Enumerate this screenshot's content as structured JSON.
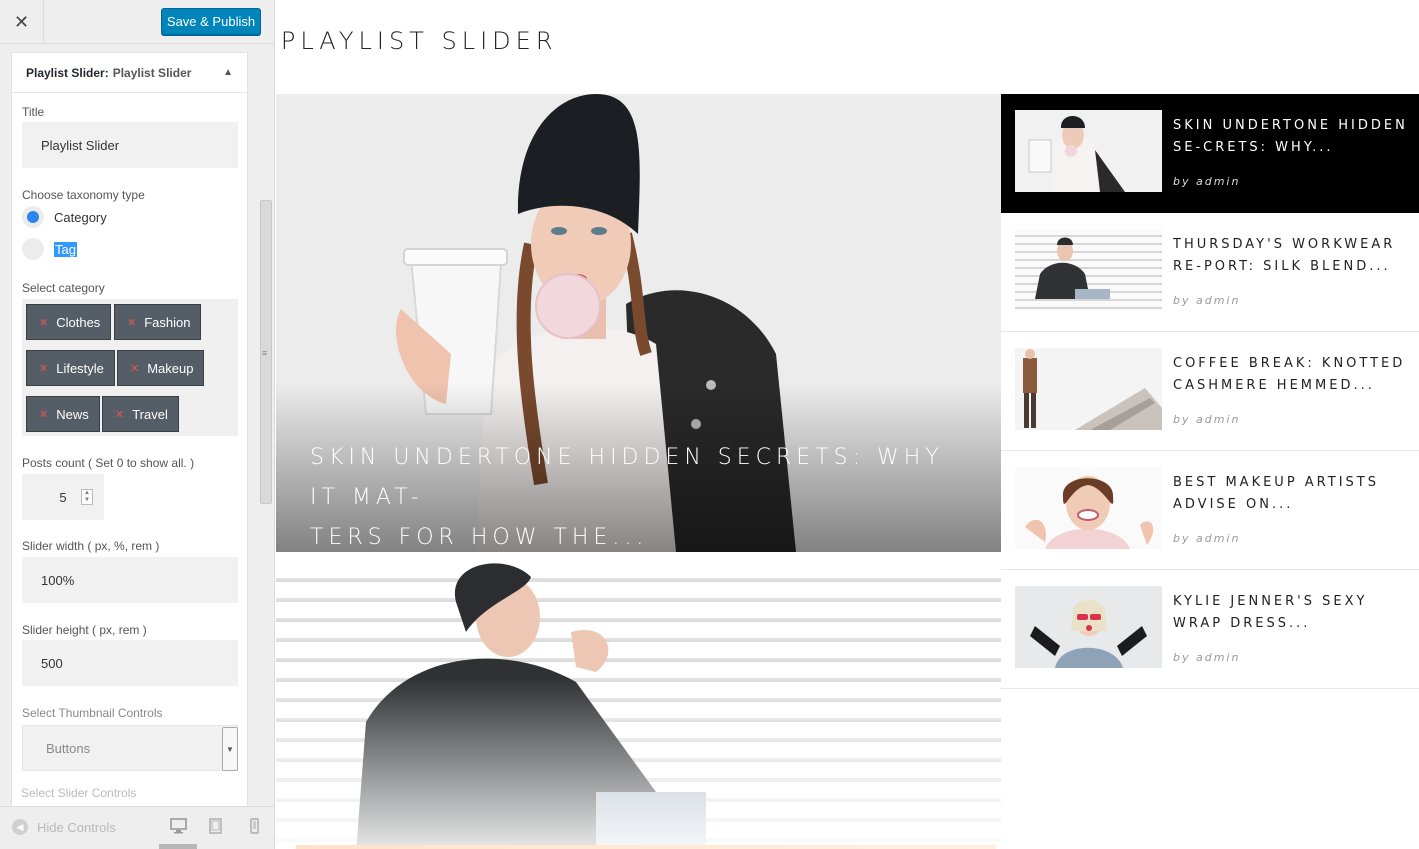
{
  "header": {
    "close_icon": "close-icon",
    "save_label": "Save & Publish"
  },
  "widget": {
    "title_prefix": "Playlist Slider:",
    "title_name": "Playlist Slider",
    "title_label": "Title",
    "title_value": "Playlist Slider",
    "taxonomy_label": "Choose taxonomy type",
    "taxonomy_options": [
      "Category",
      "Tag"
    ],
    "taxonomy_selected": "Category",
    "category_label": "Select category",
    "categories": [
      "Clothes",
      "Fashion",
      "Lifestyle",
      "Makeup",
      "News",
      "Travel"
    ],
    "posts_count_label": "Posts count ( Set 0 to show all. )",
    "posts_count_value": "5",
    "slider_width_label": "Slider width ( px, %, rem )",
    "slider_width_value": "100%",
    "slider_height_label": "Slider height ( px, rem )",
    "slider_height_value": "500",
    "thumb_controls_label": "Select Thumbnail Controls",
    "thumb_controls_value": "Buttons",
    "slider_controls_label": "Select Slider Controls"
  },
  "footer": {
    "hide_controls_label": "Hide Controls",
    "devices": [
      "desktop-icon",
      "tablet-icon",
      "mobile-icon"
    ]
  },
  "preview": {
    "page_title": "PLAYLIST SLIDER",
    "hero_caption_line1": "SKIN UNDERTONE HIDDEN SECRETS: WHY IT MAT-",
    "hero_caption_line2": "TERS FOR HOW THE...",
    "thumbs": [
      {
        "title": "SKIN UNDERTONE HIDDEN SE-CRETS: WHY...",
        "by": "by admin"
      },
      {
        "title": "THURSDAY'S WORKWEAR RE-PORT: SILK BLEND...",
        "by": "by admin"
      },
      {
        "title": "COFFEE BREAK: KNOTTED CASHMERE HEMMED...",
        "by": "by admin"
      },
      {
        "title": "BEST MAKEUP ARTISTS ADVISE ON...",
        "by": "by admin"
      },
      {
        "title": "KYLIE JENNER'S SEXY WRAP DRESS...",
        "by": "by admin"
      }
    ]
  },
  "colors": {
    "primary_button": "#0085ba",
    "chip_bg": "#555d66",
    "radio_selected": "#2b86f0",
    "active_thumb_bg": "#000000"
  }
}
